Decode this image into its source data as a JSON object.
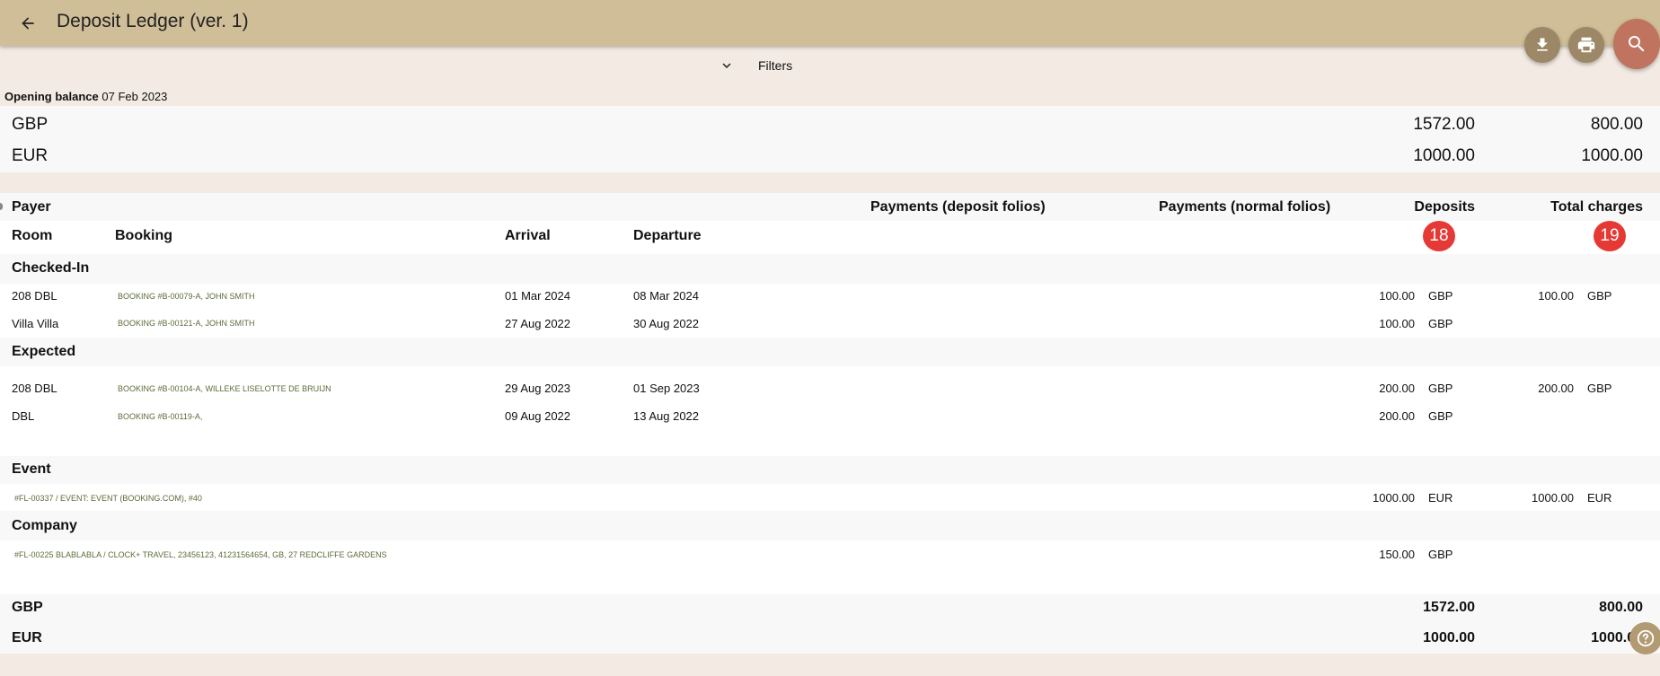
{
  "app": {
    "title": "Deposit Ledger (ver. 1)"
  },
  "toolbar": {
    "filters_label": "Filters"
  },
  "opening": {
    "label": "Opening balance",
    "date": "07 Feb 2023"
  },
  "opening_totals": [
    {
      "currency": "GBP",
      "deposits": "1572.00",
      "charges": "800.00"
    },
    {
      "currency": "EUR",
      "deposits": "1000.00",
      "charges": "1000.00"
    }
  ],
  "header": {
    "payer": "Payer",
    "payments_deposit": "Payments (deposit folios)",
    "payments_normal": "Payments (normal folios)",
    "deposits": "Deposits",
    "total_charges": "Total charges",
    "room": "Room",
    "booking": "Booking",
    "arrival": "Arrival",
    "departure": "Departure",
    "deposits_badge": "18",
    "charges_badge": "19"
  },
  "groups": {
    "checked_in": {
      "label": "Checked-In",
      "rows": [
        {
          "room": "208 DBL",
          "booking": "BOOKING #B-00079-A, JOHN SMITH",
          "arrival": "01 Mar 2024",
          "departure": "08 Mar 2024",
          "deposit": "100.00",
          "deposit_cur": "GBP",
          "charge": "100.00",
          "charge_cur": "GBP"
        },
        {
          "room": "Villa Villa",
          "booking": "BOOKING #B-00121-A, JOHN SMITH",
          "arrival": "27 Aug 2022",
          "departure": "30 Aug 2022",
          "deposit": "100.00",
          "deposit_cur": "GBP",
          "charge": "",
          "charge_cur": ""
        }
      ]
    },
    "expected": {
      "label": "Expected",
      "rows": [
        {
          "room": "208 DBL",
          "booking": "BOOKING #B-00104-A, WILLEKE LISELOTTE DE BRUIJN",
          "arrival": "29 Aug 2023",
          "departure": "01 Sep 2023",
          "deposit": "200.00",
          "deposit_cur": "GBP",
          "charge": "200.00",
          "charge_cur": "GBP"
        },
        {
          "room": "DBL",
          "booking": "BOOKING #B-00119-A,",
          "arrival": "09 Aug 2022",
          "departure": "13 Aug 2022",
          "deposit": "200.00",
          "deposit_cur": "GBP",
          "charge": "",
          "charge_cur": ""
        }
      ]
    },
    "event": {
      "label": "Event",
      "rows": [
        {
          "booking": "#FL-00337 / EVENT: EVENT (BOOKING.COM), #40",
          "deposit": "1000.00",
          "deposit_cur": "EUR",
          "charge": "1000.00",
          "charge_cur": "EUR"
        }
      ]
    },
    "company": {
      "label": "Company",
      "rows": [
        {
          "booking": "#FL-00225 BLABLABLA / CLOCK+ TRAVEL, 23456123, 41231564654, GB, 27 REDCLIFFE GARDENS",
          "deposit": "150.00",
          "deposit_cur": "GBP",
          "charge": "",
          "charge_cur": ""
        }
      ]
    }
  },
  "closing_totals": [
    {
      "currency": "GBP",
      "deposits": "1572.00",
      "charges": "800.00"
    },
    {
      "currency": "EUR",
      "deposits": "1000.00",
      "charges": "1000.00"
    }
  ],
  "icons": {
    "back": "arrow-left-icon",
    "download": "download-icon",
    "print": "print-icon",
    "search": "search-icon",
    "filters": "chevron-down-icon",
    "help": "help-icon"
  },
  "colors": {
    "topbar": "#d0be98",
    "page": "#f3ebe3",
    "fab_small": "#9c8766",
    "fab_search": "#c0735f",
    "badge": "#e53935",
    "booking_text": "#5b6b3a"
  }
}
